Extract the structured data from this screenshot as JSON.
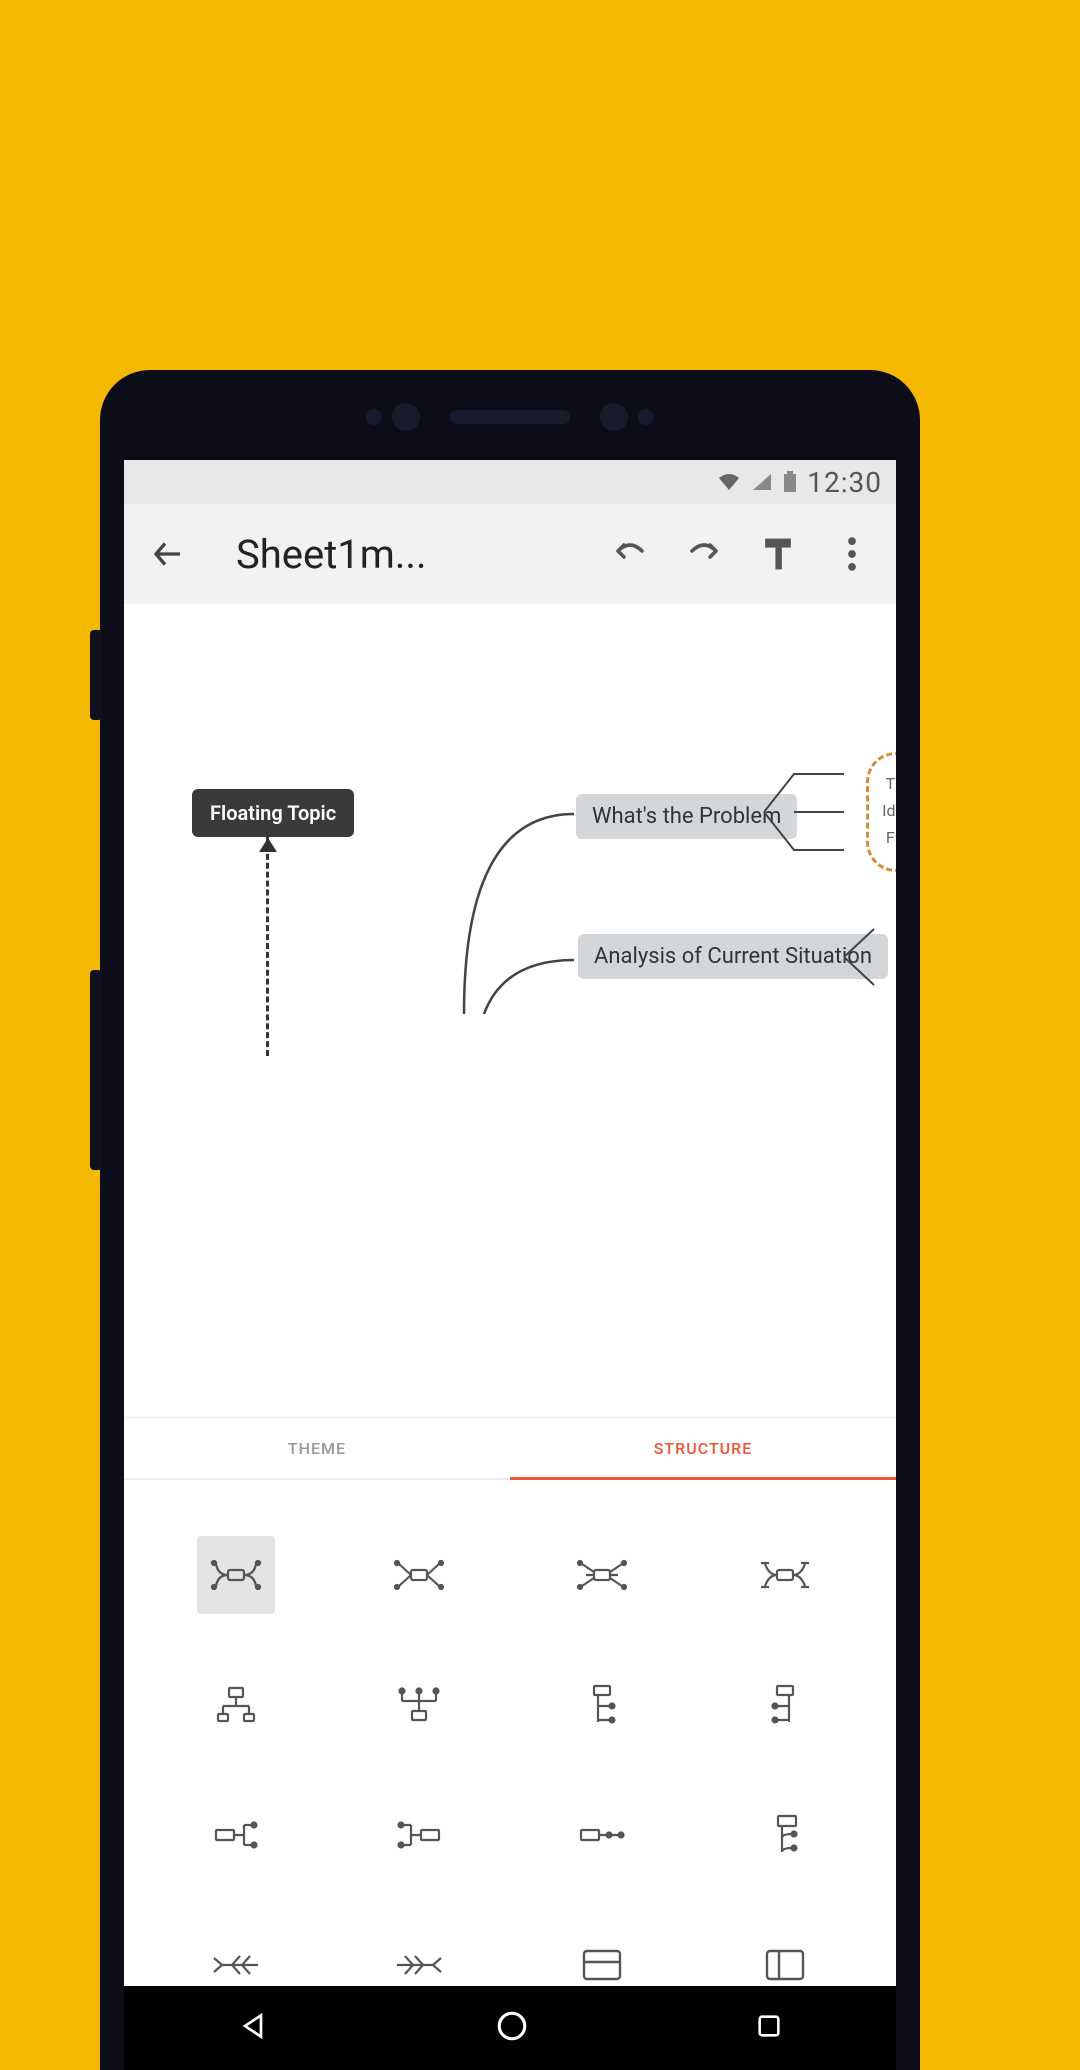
{
  "statusbar": {
    "time": "12:30"
  },
  "toolbar": {
    "title": "Sheet1m..."
  },
  "canvas": {
    "floating_topic": "Floating Topic",
    "node1": "What's the Problem",
    "node2": "Analysis of Current Situation",
    "side1": "Th",
    "side2": "Ide",
    "side3": "Fir"
  },
  "tabs": {
    "theme": "THEME",
    "structure": "STRUCTURE"
  }
}
